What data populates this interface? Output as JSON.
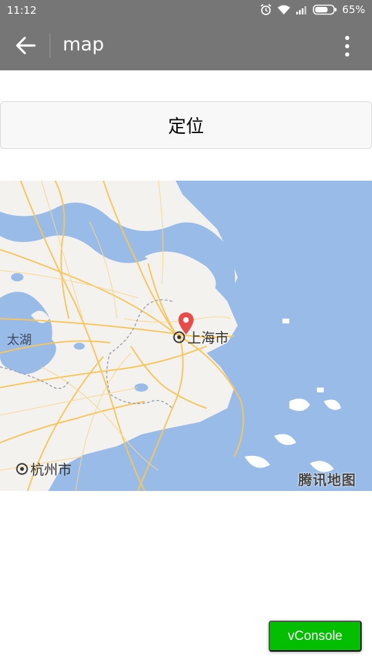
{
  "status_bar": {
    "time": "11:12",
    "battery": "65%",
    "icons": [
      "alarm-icon",
      "wifi-icon",
      "signal-icon",
      "battery-icon"
    ]
  },
  "app_bar": {
    "title": "map",
    "back_icon": "arrow-left-icon",
    "menu_icon": "more-vertical-icon"
  },
  "locate_button": {
    "label": "定位"
  },
  "map": {
    "labels": {
      "lake": "太湖",
      "shanghai": "上海市",
      "hangzhou": "杭州市",
      "brand": "腾讯地图"
    },
    "marker_icon": "map-pin-icon",
    "colors": {
      "water": "#99bbe8",
      "land": "#f4f2ee",
      "road": "#f7c65a",
      "marker": "#e94b48"
    }
  },
  "vconsole": {
    "label": "vConsole"
  }
}
